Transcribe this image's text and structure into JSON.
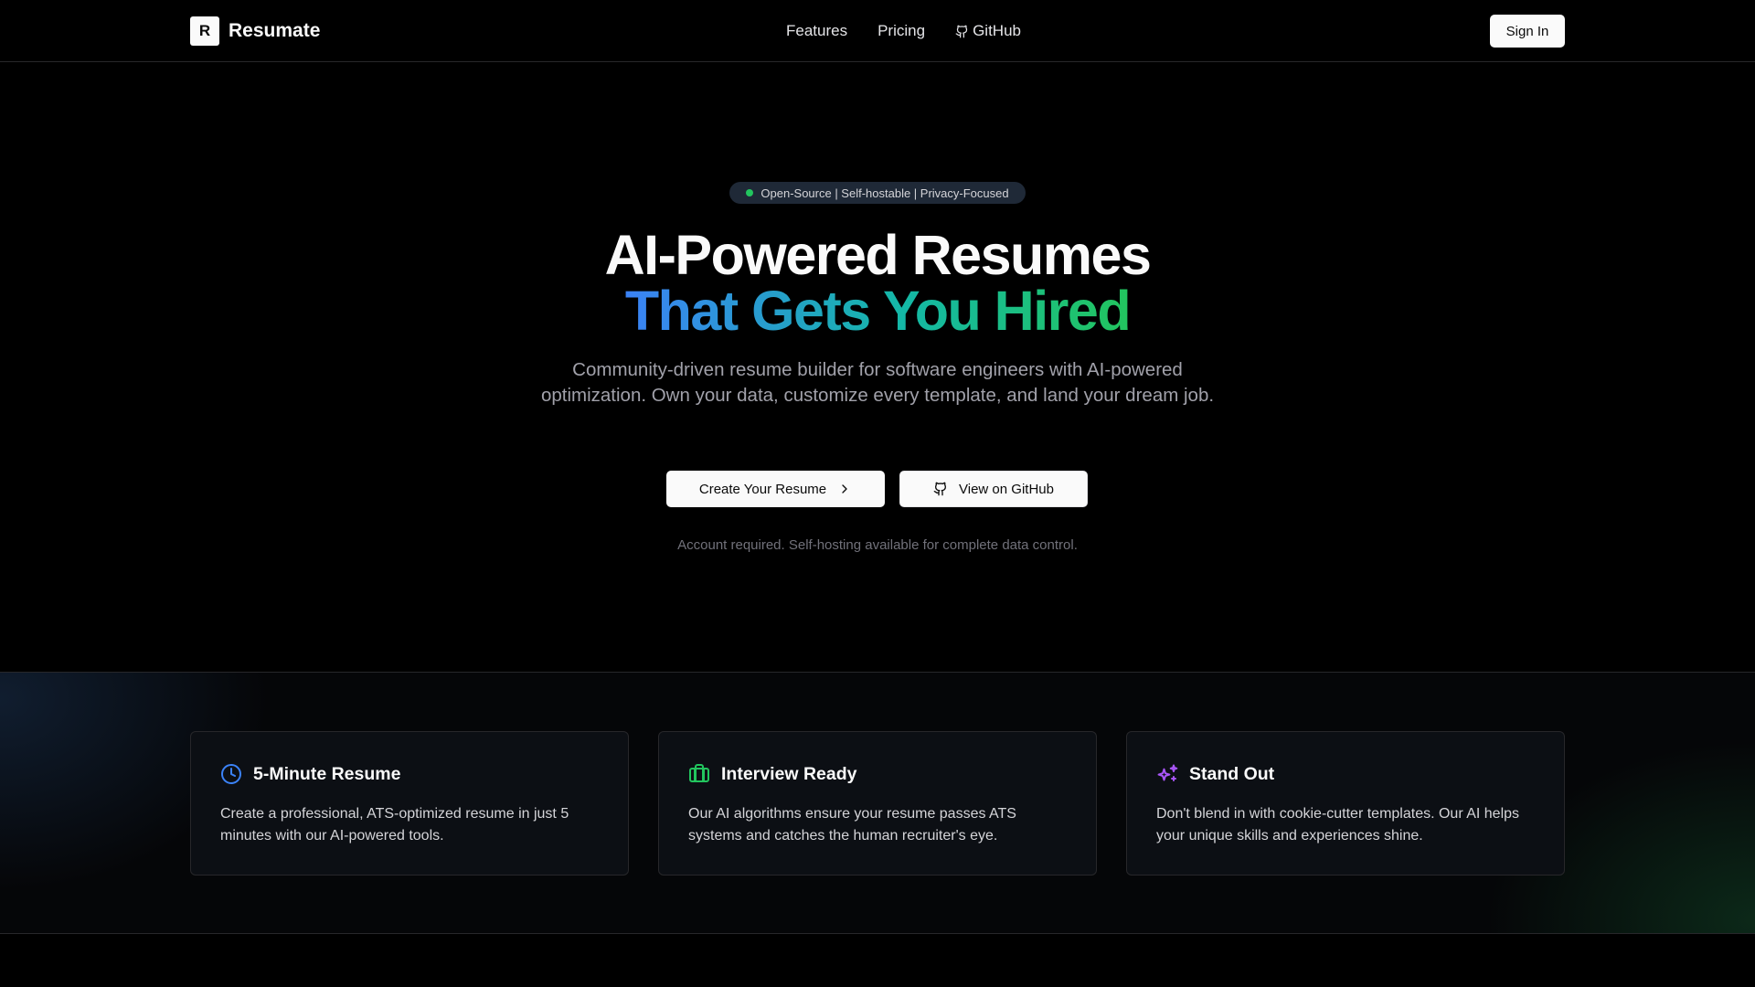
{
  "brand": {
    "logo_letter": "R",
    "name": "Resumate"
  },
  "nav": {
    "features": "Features",
    "pricing": "Pricing",
    "github": "GitHub"
  },
  "header": {
    "signin_label": "Sign In"
  },
  "hero": {
    "badge": "Open-Source | Self-hostable | Privacy-Focused",
    "title_line1": "AI-Powered Resumes",
    "title_line2": "That Gets You Hired",
    "subtitle": "Community-driven resume builder for software engineers with AI-powered optimization. Own your data, customize every template, and land your dream job.",
    "primary_cta": "Create Your Resume",
    "secondary_cta": "View on GitHub",
    "note": "Account required. Self-hosting available for complete data control."
  },
  "features": [
    {
      "icon": "clock-icon",
      "title": "5-Minute Resume",
      "description": "Create a professional, ATS-optimized resume in just 5 minutes with our AI-powered tools.",
      "color": "#3b82f6"
    },
    {
      "icon": "briefcase-icon",
      "title": "Interview Ready",
      "description": "Our AI algorithms ensure your resume passes ATS systems and catches the human recruiter's eye.",
      "color": "#22c55e"
    },
    {
      "icon": "sparkles-icon",
      "title": "Stand Out",
      "description": "Don't blend in with cookie-cutter templates. Our AI helps your unique skills and experiences shine.",
      "color": "#a855f7"
    }
  ],
  "colors": {
    "accent_blue": "#3b82f6",
    "accent_teal": "#14b8a6",
    "accent_green": "#22c55e",
    "background": "#000000"
  }
}
